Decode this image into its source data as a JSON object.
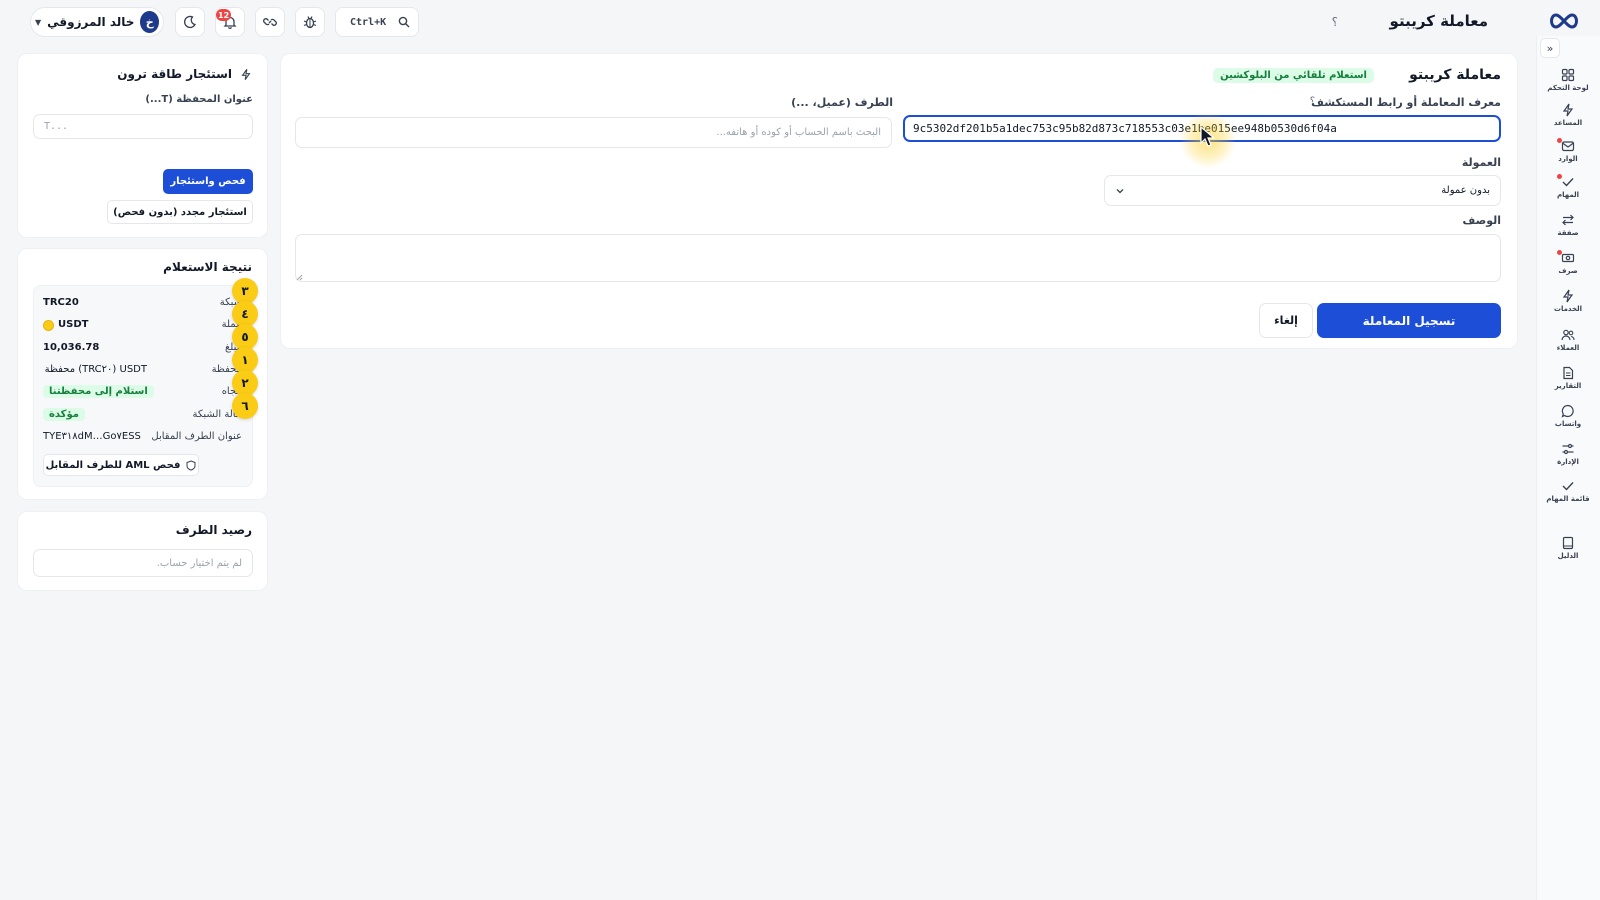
{
  "header": {
    "page_title": "معاملة كريبتو",
    "help_mark": "؟",
    "search_shortcut": "Ctrl+K",
    "notification_count": "12",
    "user_name": "خالد المرزوقي",
    "user_initial": "خ"
  },
  "sidebar": {
    "items": [
      {
        "label": "لوحة التحكم",
        "icon": "grid-icon"
      },
      {
        "label": "المساعد",
        "icon": "bolt-icon"
      },
      {
        "label": "الوارد",
        "icon": "inbox-icon",
        "dot": true
      },
      {
        "label": "المهام",
        "icon": "check-icon",
        "dot": true
      },
      {
        "label": "صفقة",
        "icon": "swap-icon"
      },
      {
        "label": "صرف",
        "icon": "cash-icon",
        "dot": true
      },
      {
        "label": "الخدمات",
        "icon": "bolt-icon"
      },
      {
        "label": "العملاء",
        "icon": "users-icon"
      },
      {
        "label": "التقارير",
        "icon": "file-icon"
      },
      {
        "label": "واتساب",
        "icon": "chat-icon"
      },
      {
        "label": "الإدارة",
        "icon": "sliders-icon"
      },
      {
        "label": "قائمة المهام",
        "icon": "check-icon"
      },
      {
        "label": "الدليل",
        "icon": "book-icon"
      }
    ]
  },
  "main": {
    "title": "معاملة كريبتو",
    "auto_badge": "استعلام تلقائي من البلوكشين",
    "tx_label": "معرف المعاملة أو رابط المستكشف",
    "tx_help": "؟",
    "tx_value": "9c5302df201b5a1dec753c95b82d873c718553c03e1be015ee948b0530d6f04a",
    "party_label": "الطرف (عميل، ...)",
    "party_placeholder": "البحث باسم الحساب أو كوده أو هاتفه...",
    "fee_label": "العمولة",
    "fee_value": "بدون عمولة",
    "desc_label": "الوصف",
    "submit_label": "تسجيل المعاملة",
    "cancel_label": "إلغاء"
  },
  "tron_card": {
    "title": "استئجار طاقة ترون",
    "wallet_label": "عنوان المحفظة (T...)",
    "wallet_placeholder": "T...",
    "check_rent_label": "فحص واستئجار",
    "rent_again_label": "استئجار مجدد (بدون فحص)"
  },
  "result_card": {
    "title": "نتيجة الاستعلام",
    "rows": [
      {
        "key": "شبكة",
        "value": "TRC20"
      },
      {
        "key": "عملة",
        "value": "USDT"
      },
      {
        "key": "مبلغ",
        "value": "10,036.78"
      },
      {
        "key": "محفظة",
        "value": "USDT (TRC٢٠) محفظة"
      },
      {
        "key": "اتجاه",
        "value": "استلام إلى محفظتنا"
      },
      {
        "key": "حالة الشبكة",
        "value": "مؤكدة"
      },
      {
        "key": "عنوان الطرف المقابل",
        "value": "TYE٣١٨dM…Go٧ESS"
      }
    ],
    "aml_label": "فحص AML للطرف المقابل",
    "bubbles": [
      "٣",
      "٤",
      "٥",
      "١",
      "٢",
      "٦"
    ]
  },
  "balance_card": {
    "title": "رصيد الطرف",
    "empty_text": "لم يتم اختيار حساب."
  },
  "colors": {
    "accent": "#1d4ed8",
    "success": "#15803d",
    "highlight": "#facc15"
  }
}
